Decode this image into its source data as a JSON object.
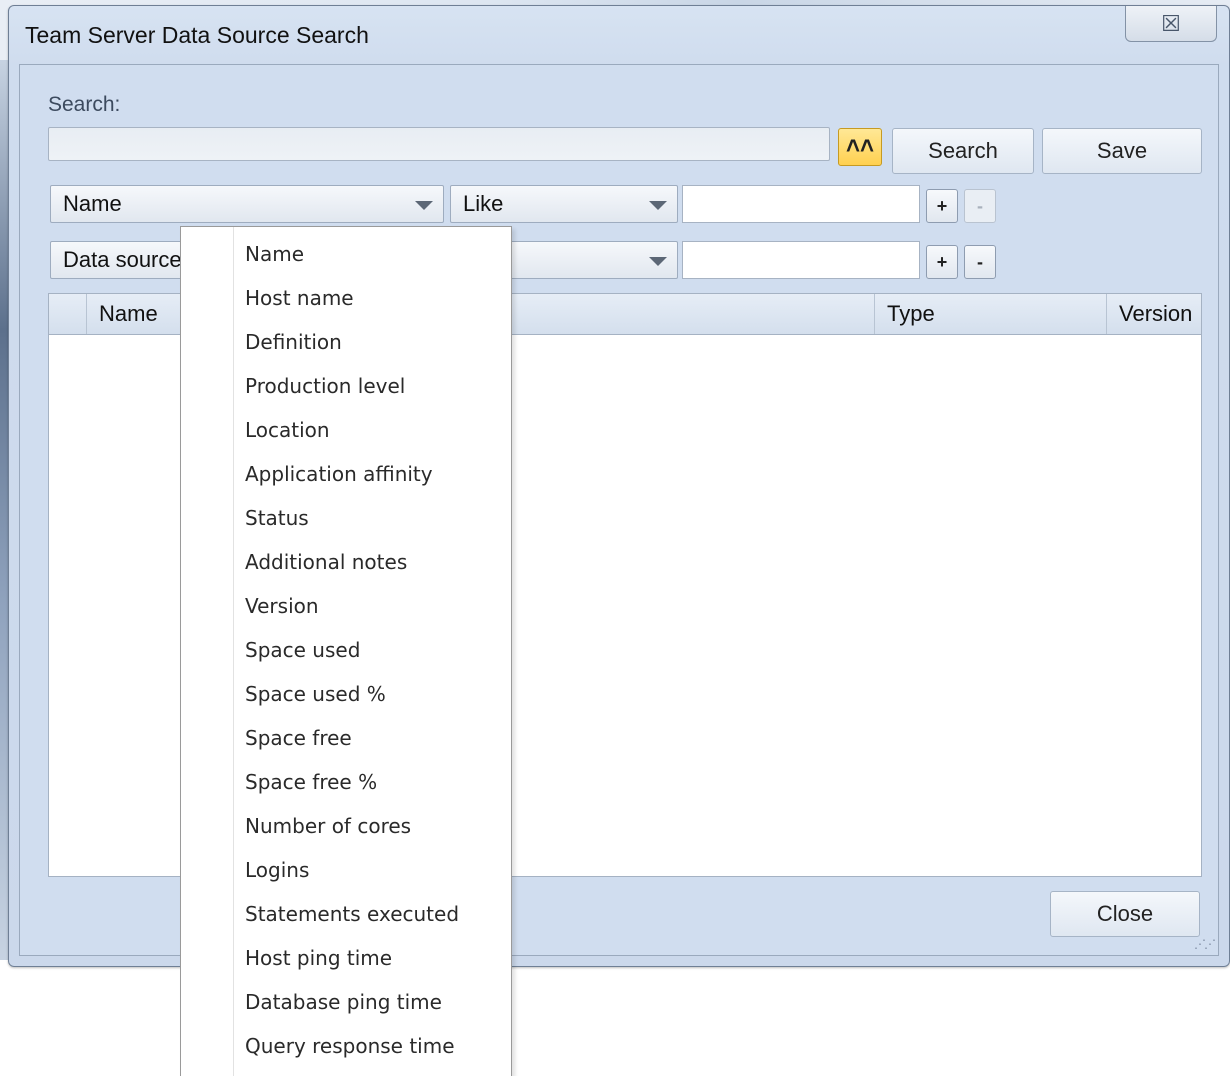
{
  "window": {
    "title": "Team Server Data Source Search",
    "close_glyph": "☒"
  },
  "search": {
    "label": "Search:",
    "query_value": "",
    "collapse_glyph": "˄˄",
    "search_label": "Search",
    "save_label": "Save"
  },
  "filters": [
    {
      "field": "Name",
      "operator": "Like",
      "value": "",
      "add": "+",
      "remove": "-",
      "remove_enabled": false
    },
    {
      "field": "Data source",
      "operator": "",
      "value": "",
      "add": "+",
      "remove": "-",
      "remove_enabled": true
    }
  ],
  "grid": {
    "columns": [
      "Name",
      "Type",
      "Version"
    ],
    "rows": []
  },
  "footer": {
    "close_label": "Close"
  },
  "dropdown": {
    "items": [
      "Name",
      "Host name",
      "Definition",
      "Production level",
      "Location",
      "Application affinity",
      "Status",
      "Additional notes",
      "Version",
      "Space used",
      "Space used %",
      "Space free",
      "Space free %",
      "Number of cores",
      "Logins",
      "Statements executed",
      "Host ping time",
      "Database ping time",
      "Query response time"
    ]
  }
}
